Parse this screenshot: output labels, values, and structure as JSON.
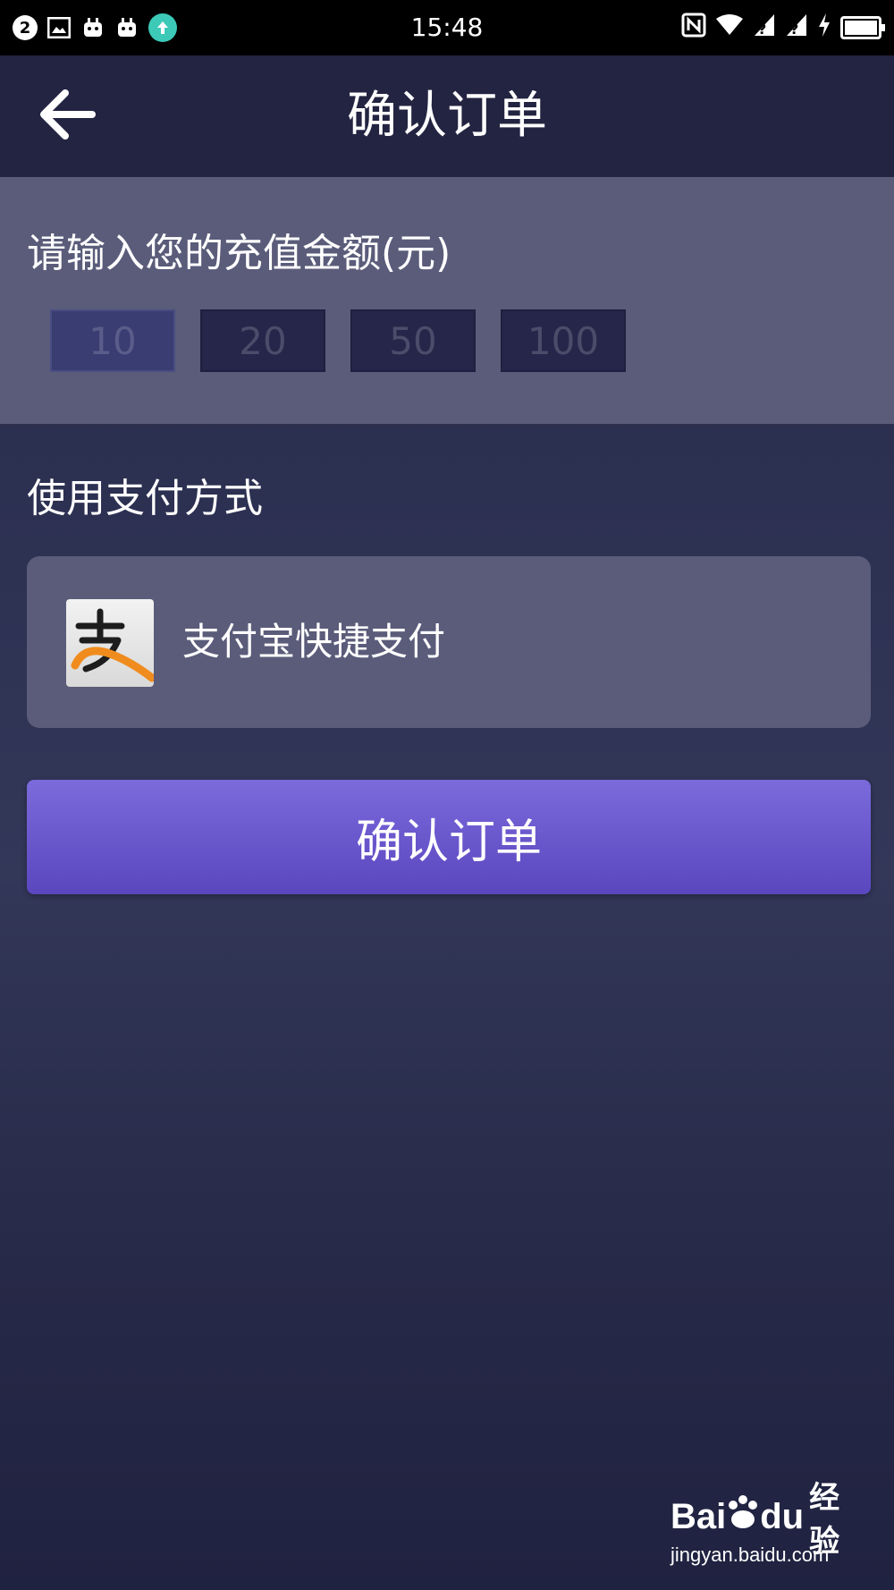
{
  "status_bar": {
    "time": "15:48",
    "notification_badge": "2",
    "left_icons": [
      "notification-count-icon",
      "image-icon",
      "app-icon",
      "app-icon",
      "upload-icon"
    ],
    "right_icons": [
      "nfc-icon",
      "wifi-icon",
      "signal-icon",
      "signal-icon",
      "charging-icon",
      "battery-icon"
    ]
  },
  "header": {
    "title": "确认订单",
    "back_icon": "arrow-left-icon"
  },
  "amount": {
    "label": "请输入您的充值金额(元)",
    "options": [
      "10",
      "20",
      "50",
      "100"
    ],
    "selected": "10"
  },
  "payment": {
    "section_title": "使用支付方式",
    "method_name": "支付宝快捷支付",
    "method_icon": "alipay-icon"
  },
  "confirm_button": {
    "label": "确认订单"
  },
  "watermark": {
    "brand": "Bai",
    "brand_suffix": "du",
    "product": "经验",
    "url": "jingyan.baidu.com"
  },
  "colors": {
    "background": "#2d3152",
    "header": "#232441",
    "panel": "#5a5c7a",
    "button_accent": "#6a58cd",
    "alipay_orange": "#f08c1e"
  }
}
